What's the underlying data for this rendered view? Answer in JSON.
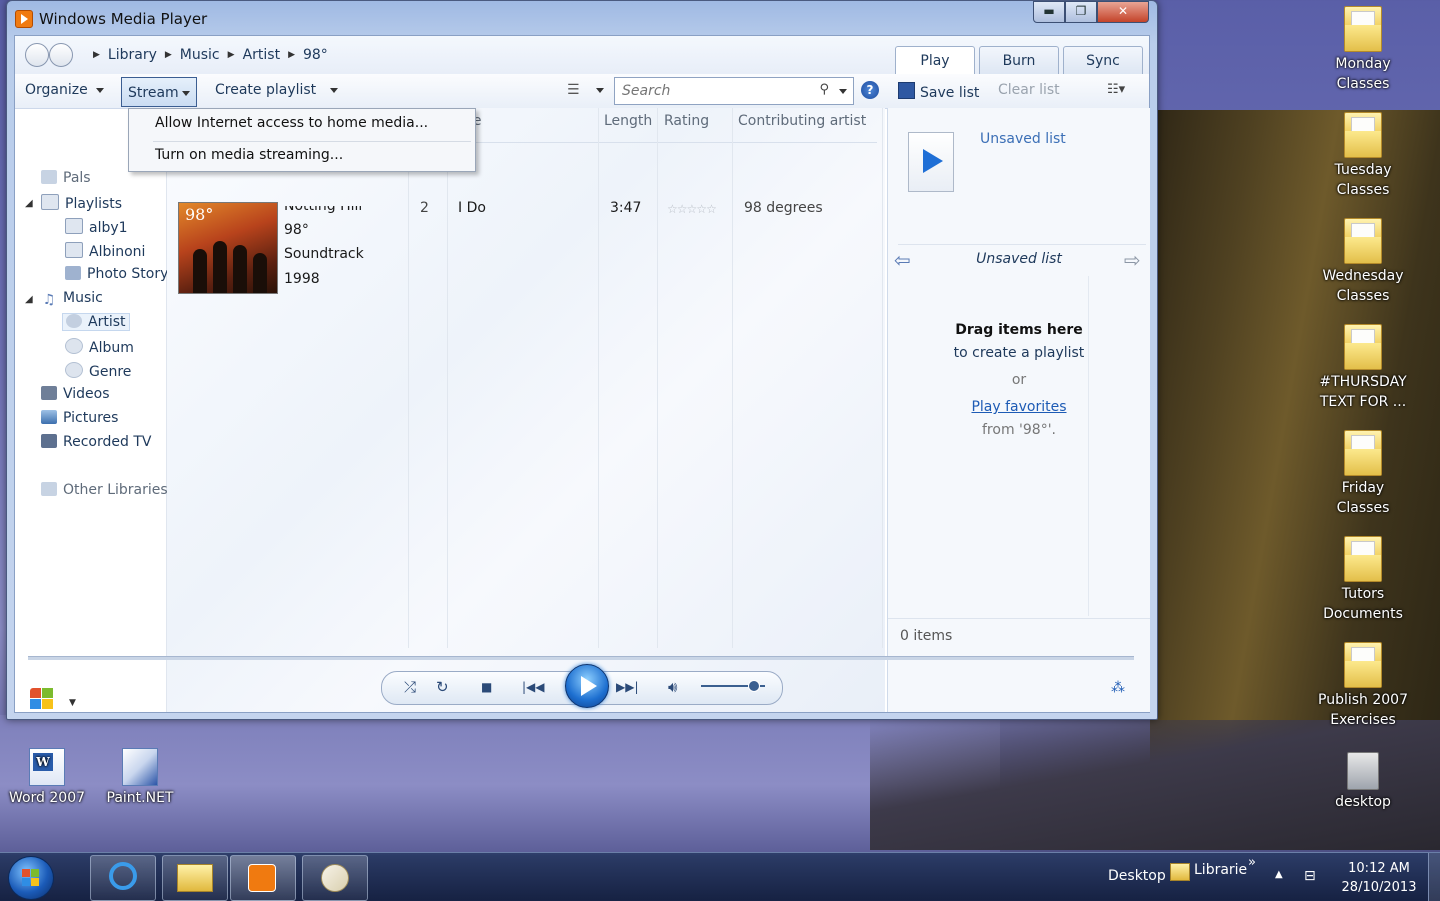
{
  "window": {
    "title": "Windows Media Player",
    "minimize": "▬",
    "maximize": "❐",
    "close": "✕"
  },
  "breadcrumb": [
    "Library",
    "Music",
    "Artist",
    "98°"
  ],
  "tabs": [
    "Play",
    "Burn",
    "Sync"
  ],
  "toolbar": {
    "organize": "Organize",
    "stream": "Stream",
    "create_playlist": "Create playlist",
    "search_placeholder": "Search",
    "help": "?",
    "save_list": "Save list",
    "clear_list": "Clear list"
  },
  "stream_menu": {
    "items": [
      "Allow Internet access to home media...",
      "Turn on media streaming..."
    ]
  },
  "nav_tree": {
    "pals": "Pals",
    "playlists": "Playlists",
    "playlist_items": [
      "alby1",
      "Albinoni",
      "Photo Story"
    ],
    "music": "Music",
    "music_items": [
      "Artist",
      "Album",
      "Genre"
    ],
    "videos": "Videos",
    "pictures": "Pictures",
    "recorded_tv": "Recorded TV",
    "other_libraries": "Other Libraries"
  },
  "columns": {
    "title_partial": "le",
    "length": "Length",
    "rating": "Rating",
    "contributing_artist": "Contributing artist"
  },
  "album": {
    "title": "Notting Hill",
    "artist": "98°",
    "genre": "Soundtrack",
    "year": "1998",
    "cover_text": "98°"
  },
  "track": {
    "number": "2",
    "title": "I Do",
    "length": "3:47",
    "rating_stars": 0,
    "contributing_artist": "98 degrees"
  },
  "list_pane": {
    "list_name": "Unsaved list",
    "header_name": "Unsaved list",
    "drag_bold": "Drag items here",
    "drag_sub": "to create a playlist",
    "or": "or",
    "play_favorites": "Play favorites",
    "from_text": "from '98°'.",
    "items_count": "0 items"
  },
  "desktop_icons": [
    {
      "label": "Monday\nClasses"
    },
    {
      "label": "Tuesday\nClasses"
    },
    {
      "label": "Wednesday\nClasses"
    },
    {
      "label": "#THURSDAY\nTEXT FOR ..."
    },
    {
      "label": "Friday\nClasses"
    },
    {
      "label": "Tutors\nDocuments"
    },
    {
      "label": "Publish 2007\nExercises"
    },
    {
      "label": "desktop"
    },
    {
      "label": "Word 2007"
    },
    {
      "label": "Paint.NET"
    }
  ],
  "taskbar": {
    "desktop": "Desktop",
    "librarie": "Librarie",
    "chevron": "»",
    "time": "10:12 AM",
    "date": "28/10/2013"
  },
  "colors": {
    "accent": "#1e395b",
    "link": "#1d5bb5",
    "play_button": "#1d6fd0"
  }
}
